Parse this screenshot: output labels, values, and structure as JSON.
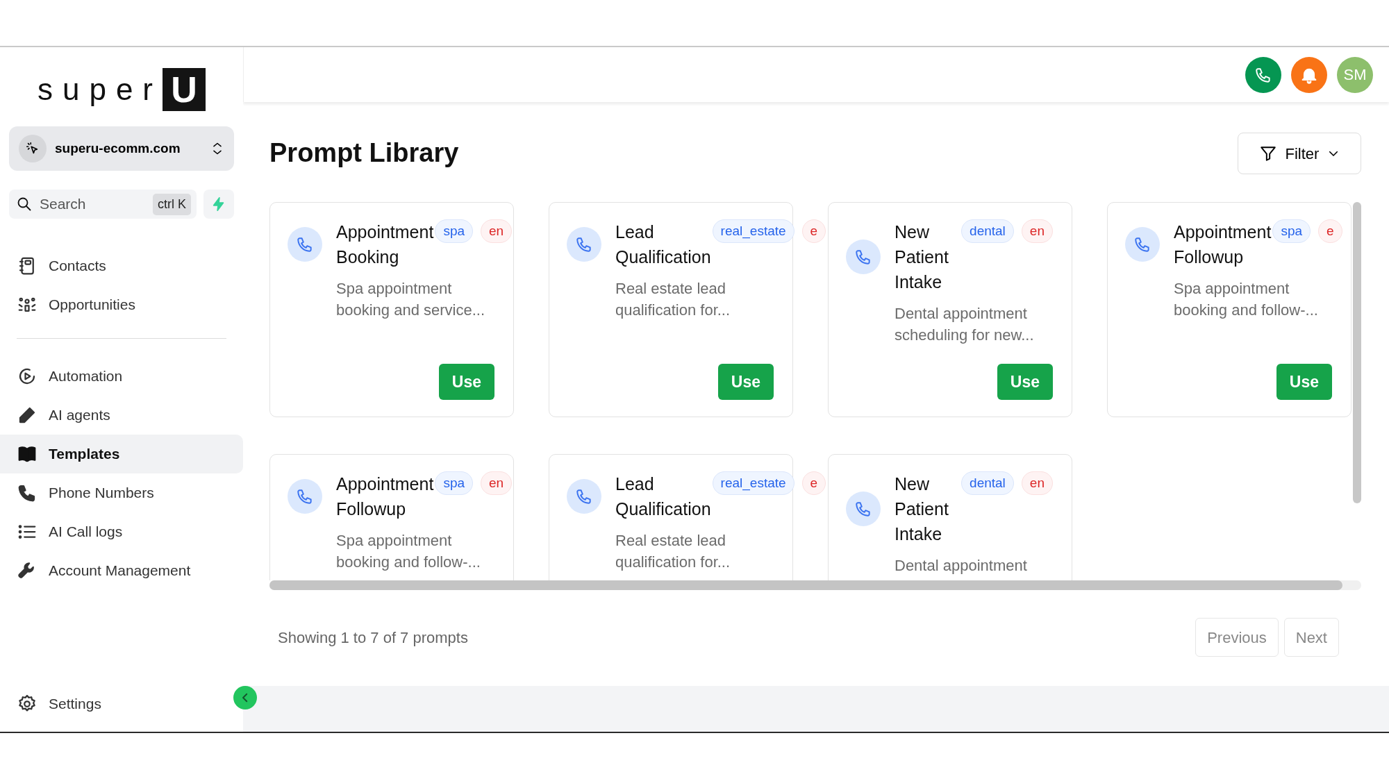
{
  "sidebar": {
    "logo": {
      "text": "super",
      "mark": "U"
    },
    "workspace": {
      "name": "superu-ecomm.com"
    },
    "search": {
      "placeholder": "Search",
      "shortcut": "ctrl K"
    },
    "nav_groups": [
      [
        {
          "label": "Contacts",
          "selected": false
        },
        {
          "label": "Opportunities",
          "selected": false
        }
      ],
      [
        {
          "label": "Automation",
          "selected": false
        },
        {
          "label": "AI agents",
          "selected": false
        },
        {
          "label": "Templates",
          "selected": true
        },
        {
          "label": "Phone Numbers",
          "selected": false
        },
        {
          "label": "AI Call logs",
          "selected": false
        },
        {
          "label": "Account Management",
          "selected": false
        }
      ]
    ],
    "footer": {
      "label": "Settings"
    }
  },
  "header": {
    "avatar": "SM"
  },
  "page": {
    "title": "Prompt Library",
    "filter": "Filter"
  },
  "cards": [
    {
      "title": "Appointment Booking",
      "tags": [
        {
          "label": "spa",
          "kind": "category"
        },
        {
          "label": "en",
          "kind": "language"
        }
      ],
      "description": "Spa appointment booking and service...",
      "action": "Use"
    },
    {
      "title": "Lead Qualification",
      "tags": [
        {
          "label": "real_estate",
          "kind": "category"
        },
        {
          "label": "e",
          "kind": "language"
        }
      ],
      "description": "Real estate lead qualification for...",
      "action": "Use"
    },
    {
      "title": "New Patient Intake",
      "tags": [
        {
          "label": "dental",
          "kind": "category"
        },
        {
          "label": "en",
          "kind": "language"
        }
      ],
      "description": "Dental appointment scheduling for new...",
      "action": "Use"
    },
    {
      "title": "Appointment Followup",
      "tags": [
        {
          "label": "spa",
          "kind": "category"
        },
        {
          "label": "e",
          "kind": "language"
        }
      ],
      "description": "Spa appointment booking and follow-...",
      "action": "Use"
    },
    {
      "title": "Appointment Followup",
      "tags": [
        {
          "label": "spa",
          "kind": "category"
        },
        {
          "label": "en",
          "kind": "language"
        }
      ],
      "description": "Spa appointment booking and follow-..."
    },
    {
      "title": "Lead Qualification",
      "tags": [
        {
          "label": "real_estate",
          "kind": "category"
        },
        {
          "label": "e",
          "kind": "language"
        }
      ],
      "description": "Real estate lead qualification for..."
    },
    {
      "title": "New Patient Intake",
      "tags": [
        {
          "label": "dental",
          "kind": "category"
        },
        {
          "label": "en",
          "kind": "language"
        }
      ],
      "description": "Dental appointment"
    }
  ],
  "pagination": {
    "summary": "Showing 1 to 7 of 7 prompts",
    "buttons": [
      "Previous",
      "Next"
    ]
  }
}
